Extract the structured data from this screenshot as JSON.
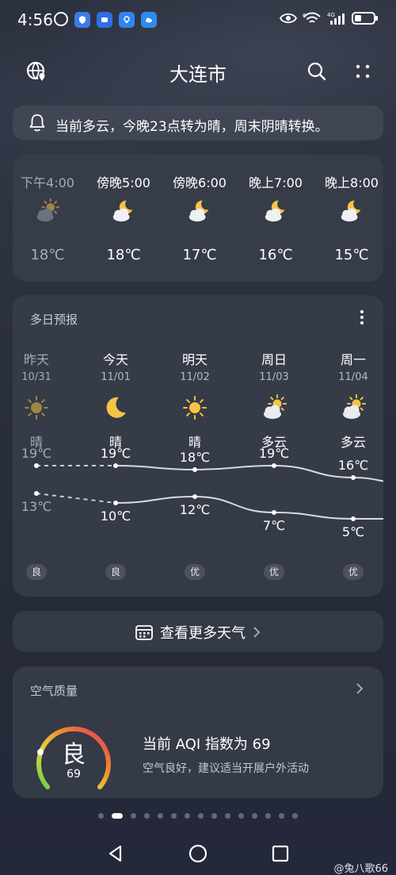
{
  "status_bar": {
    "time": "4:56",
    "network_label": "4G",
    "sim_label": "6"
  },
  "header": {
    "title": "大连市",
    "left_icon": "globe-location-icon",
    "search_icon": "search-icon",
    "menu_icon": "more-dots-icon"
  },
  "alert": {
    "icon": "bell-icon",
    "text": "当前多云，今晚23点转为晴，周末阴晴转换。"
  },
  "hourly": [
    {
      "label": "下午4:00",
      "temp": "18℃",
      "icon": "sunny-cloudy-icon",
      "dim": true
    },
    {
      "label": "傍晚5:00",
      "temp": "18℃",
      "icon": "moon-cloud-icon",
      "dim": false
    },
    {
      "label": "傍晚6:00",
      "temp": "17℃",
      "icon": "moon-cloud-icon",
      "dim": false
    },
    {
      "label": "晚上7:00",
      "temp": "16℃",
      "icon": "moon-cloud-icon",
      "dim": false
    },
    {
      "label": "晚上8:00",
      "temp": "15℃",
      "icon": "moon-cloud-icon",
      "dim": false
    }
  ],
  "daily": {
    "title": "多日预报",
    "days": [
      {
        "name": "昨天",
        "date": "10/31",
        "cond": "晴",
        "icon": "sun-icon",
        "high": 19,
        "low": 13,
        "high_label": "19℃",
        "low_label": "13℃",
        "aqi": "良",
        "past": true
      },
      {
        "name": "今天",
        "date": "11/01",
        "cond": "晴",
        "icon": "moon-icon",
        "high": 19,
        "low": 10,
        "high_label": "19℃",
        "low_label": "10℃",
        "aqi": "良",
        "past": false
      },
      {
        "name": "明天",
        "date": "11/02",
        "cond": "晴",
        "icon": "sun-icon",
        "high": 18,
        "low": 12,
        "high_label": "18℃",
        "low_label": "12℃",
        "aqi": "优",
        "past": false
      },
      {
        "name": "周日",
        "date": "11/03",
        "cond": "多云",
        "icon": "sun-cloud-icon",
        "high": 19,
        "low": 7,
        "high_label": "19℃",
        "low_label": "7℃",
        "aqi": "优",
        "past": false
      },
      {
        "name": "周一",
        "date": "11/04",
        "cond": "多云",
        "icon": "sun-cloud-icon",
        "high": 16,
        "low": 5,
        "high_label": "16℃",
        "low_label": "5℃",
        "aqi": "优",
        "past": false
      }
    ]
  },
  "more_weather": {
    "icon": "calendar-icon",
    "label": "查看更多天气"
  },
  "air_quality": {
    "title": "空气质量",
    "grade": "良",
    "aqi": "69",
    "aqi_value": 69,
    "headline": "当前 AQI 指数为 69",
    "advice": "空气良好，建议适当开展户外活动"
  },
  "pager": {
    "count": 15,
    "active": 1
  },
  "watermark": "@兔八歌66",
  "colors": {
    "sun": "#f5c242",
    "moon": "#f6c445",
    "accent": "#ffffff"
  }
}
